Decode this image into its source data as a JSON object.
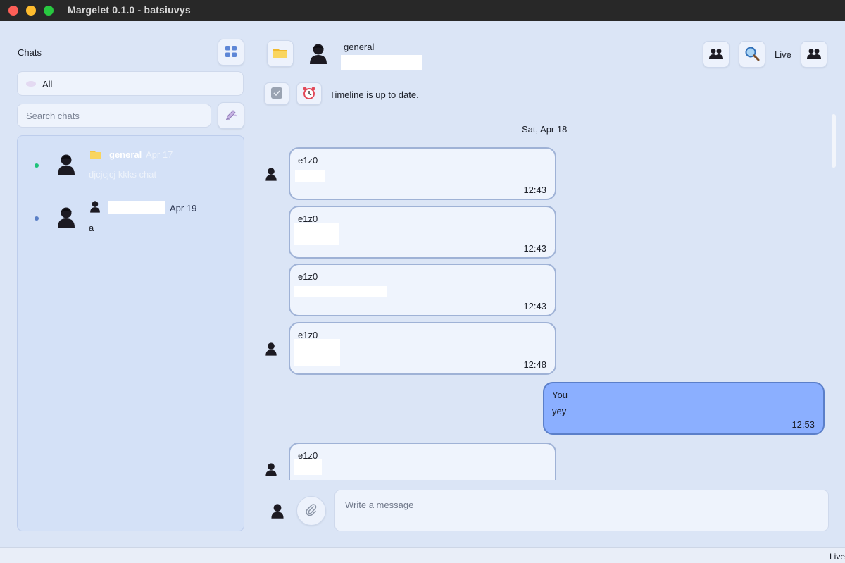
{
  "window": {
    "title": "Margelet 0.1.0 - batsiuvys"
  },
  "sidebar": {
    "heading": "Chats",
    "filter": {
      "label": "All"
    },
    "search": {
      "placeholder": "Search chats"
    },
    "chats": [
      {
        "name": "general",
        "date": "Apr 17",
        "preview": "djcjcjcj kkks chat",
        "status_color": "#1ec27a"
      },
      {
        "name": "",
        "date": "Apr 19",
        "preview": "a",
        "status_color": "#5a7fc6"
      }
    ]
  },
  "header": {
    "chat_name": "general",
    "live_label": "Live",
    "timeline_status": "Timeline is up to date."
  },
  "messages": {
    "date_separator": "Sat, Apr 18",
    "items": [
      {
        "sender": "e1z0",
        "text": "",
        "time": "12:43",
        "mine": false
      },
      {
        "sender": "e1z0",
        "text": "",
        "time": "12:43",
        "mine": false
      },
      {
        "sender": "e1z0",
        "text": "",
        "time": "12:43",
        "mine": false
      },
      {
        "sender": "e1z0",
        "text": "",
        "time": "12:48",
        "mine": false
      },
      {
        "sender": "You",
        "text": "yey",
        "time": "12:53",
        "mine": true
      },
      {
        "sender": "e1z0",
        "text": "",
        "time": "",
        "mine": false
      }
    ]
  },
  "composer": {
    "placeholder": "Write a message"
  },
  "statusbar": {
    "text": "Live"
  },
  "colors": {
    "background": "#dbe5f6",
    "own_bubble": "#8bafff",
    "accent": "#5b7fc9"
  }
}
